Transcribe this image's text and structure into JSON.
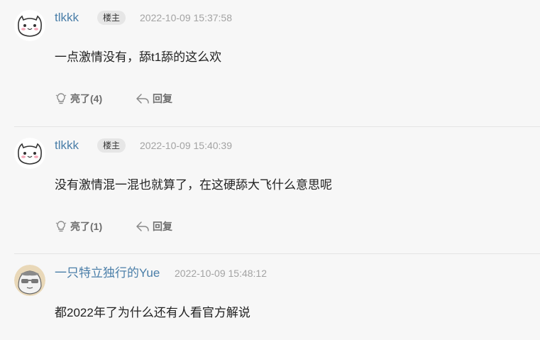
{
  "comments": [
    {
      "username": "tlkkk",
      "badge": "楼主",
      "time": "2022-10-09 15:37:58",
      "content": "一点激情没有，舔t1舔的这么欢",
      "like_label": "亮了(4)",
      "reply_label": "回复",
      "avatar_icon": "cat-avatar-icon"
    },
    {
      "username": "tlkkk",
      "badge": "楼主",
      "time": "2022-10-09 15:40:39",
      "content": "没有激情混一混也就算了，在这硬舔大飞什么意思呢",
      "like_label": "亮了(1)",
      "reply_label": "回复",
      "avatar_icon": "cat-avatar-icon"
    },
    {
      "username": "一只特立独行的Yue",
      "time": "2022-10-09 15:48:12",
      "content": "都2022年了为什么还有人看官方解说",
      "avatar_icon": "sunglasses-avatar-icon"
    }
  ],
  "colors": {
    "background": "#f7f7f7",
    "username": "#4a7ea8",
    "badge_bg": "#e6e6e6",
    "time": "#a3a3a3",
    "action": "#6e6e6e"
  }
}
